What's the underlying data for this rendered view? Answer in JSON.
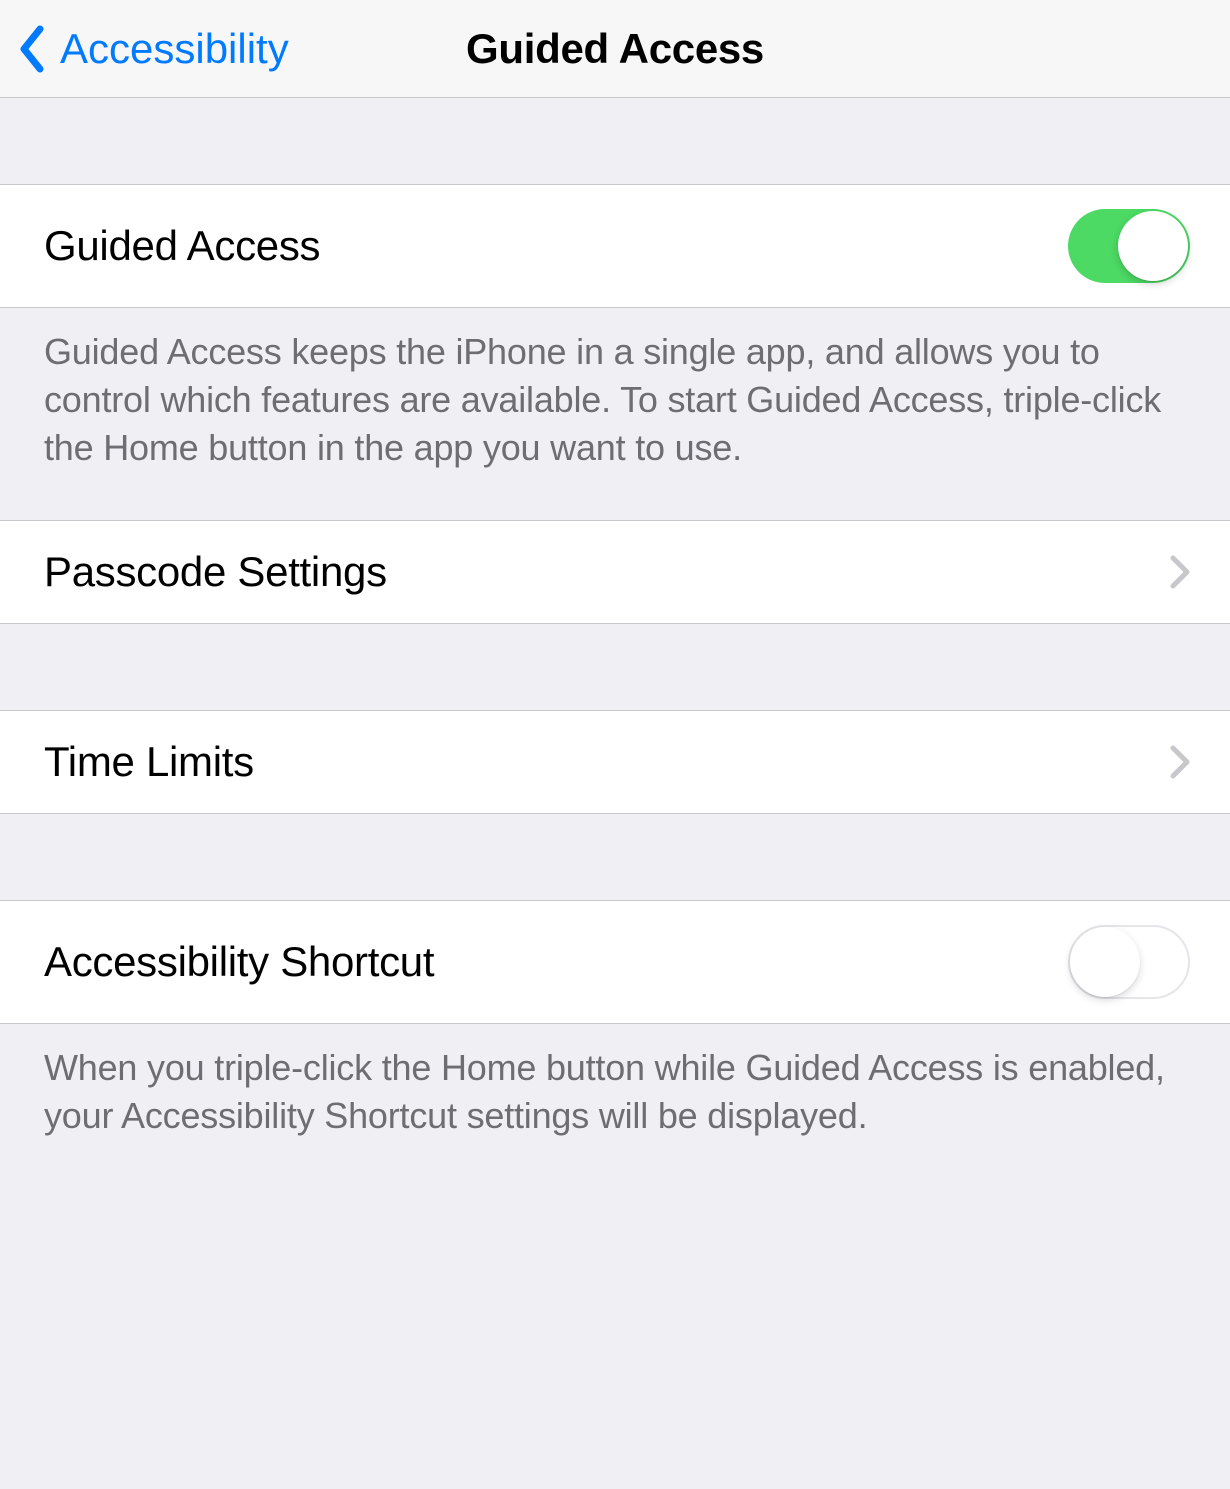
{
  "nav": {
    "back_label": "Accessibility",
    "title": "Guided Access"
  },
  "rows": {
    "guided_access": {
      "label": "Guided Access",
      "enabled": true,
      "footer": "Guided Access keeps the iPhone in a single app, and allows you to control which features are available. To start Guided Access, triple-click the Home button in the app you want to use."
    },
    "passcode_settings": {
      "label": "Passcode Settings"
    },
    "time_limits": {
      "label": "Time Limits"
    },
    "accessibility_shortcut": {
      "label": "Accessibility Shortcut",
      "enabled": false,
      "footer": "When you triple-click the Home button while Guided Access is enabled, your Accessibility Shortcut settings will be displayed."
    }
  }
}
